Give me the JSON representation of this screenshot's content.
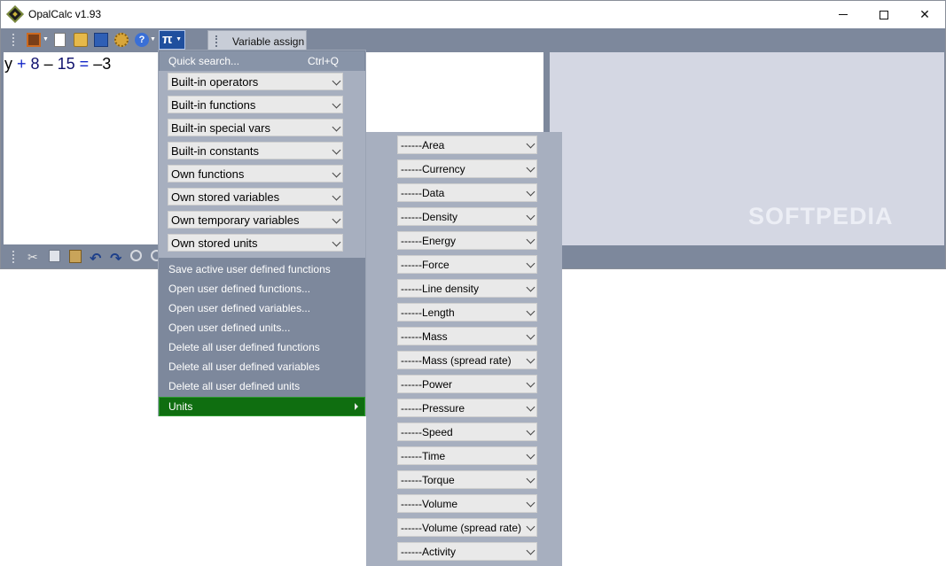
{
  "window": {
    "title": "OpalCalc v1.93",
    "minimize": "minimize",
    "maximize": "maximize",
    "close": "close"
  },
  "toolbar": {
    "icons": [
      "book-icon",
      "new-icon",
      "open-folder-icon",
      "save-icon",
      "gear-icon",
      "help-icon"
    ],
    "pi_label": "π",
    "tab_label": "Variable assign"
  },
  "editor": {
    "expression": {
      "var": "y",
      "plus": "+",
      "n1": "8",
      "minus": "–",
      "n2": "15",
      "eq": "=",
      "result": "–3"
    }
  },
  "watermark": "SOFTPEDIA",
  "pi_menu": {
    "quick_search": "Quick search...",
    "quick_search_shortcut": "Ctrl+Q",
    "combos": [
      "Built-in operators",
      "Built-in functions",
      "Built-in special vars",
      "Built-in constants",
      "Own functions",
      "Own stored variables",
      "Own temporary variables",
      "Own stored units"
    ],
    "items": [
      "Save active user defined functions",
      "Open user defined functions...",
      "Open user defined variables...",
      "Open user defined units...",
      "Delete all user defined functions",
      "Delete all user defined variables",
      "Delete all user defined units"
    ],
    "units": "Units"
  },
  "units_menu": {
    "items": [
      "------Area",
      "------Currency",
      "------Data",
      "------Density",
      "------Energy",
      "------Force",
      "------Line density",
      "------Length",
      "------Mass",
      "------Mass (spread rate)",
      "------Power",
      "------Pressure",
      "------Speed",
      "------Time",
      "------Torque",
      "------Volume",
      "------Volume (spread rate)",
      "------Activity"
    ]
  }
}
